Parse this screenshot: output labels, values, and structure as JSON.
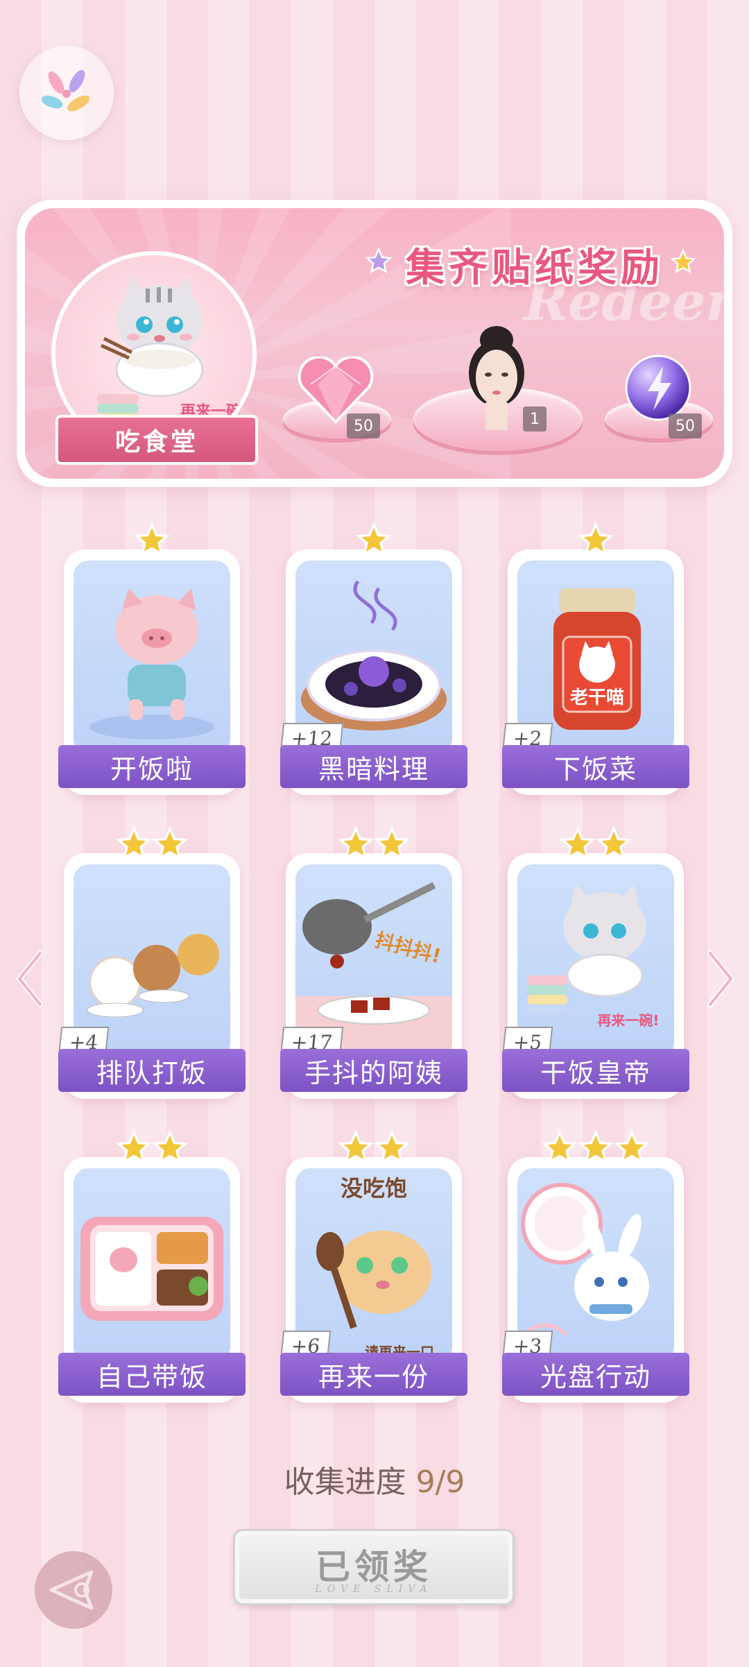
{
  "banner": {
    "title": "集齐贴纸奖励",
    "watermark": "Redeem",
    "badge_label": "吃食堂",
    "badge_caption": "再来一碗!",
    "rewards": [
      {
        "icon": "pink-heart-gem-icon",
        "count": "50"
      },
      {
        "icon": "character-portrait-icon",
        "count": "1"
      },
      {
        "icon": "purple-lightning-orb-icon",
        "count": "50"
      }
    ]
  },
  "cards": [
    {
      "label": "开饭啦",
      "stars": 1,
      "bonus": "",
      "art": "running-pig"
    },
    {
      "label": "黑暗料理",
      "stars": 1,
      "bonus": "+12",
      "art": "dark-dish"
    },
    {
      "label": "下饭菜",
      "stars": 1,
      "bonus": "+2",
      "art": "chili-jar",
      "art_text": "老干喵"
    },
    {
      "label": "排队打饭",
      "stars": 2,
      "bonus": "+4",
      "art": "queue-animals"
    },
    {
      "label": "手抖的阿姨",
      "stars": 2,
      "bonus": "+17",
      "art": "shaky-ladle",
      "art_text": "抖抖抖!"
    },
    {
      "label": "干饭皇帝",
      "stars": 2,
      "bonus": "+5",
      "art": "cat-eating",
      "art_text": "再来一碗!"
    },
    {
      "label": "自己带饭",
      "stars": 2,
      "bonus": "",
      "art": "bento-box"
    },
    {
      "label": "再来一份",
      "stars": 2,
      "bonus": "+6",
      "art": "hamster-spoon",
      "art_text": "没吃饱",
      "art_text2": "请再来一口"
    },
    {
      "label": "光盘行动",
      "stars": 3,
      "bonus": "+3",
      "art": "bunny-plate"
    }
  ],
  "progress": {
    "label": "收集进度",
    "value": "9/9"
  },
  "claim_button": {
    "label": "已领奖",
    "sub": "LOVE SLIVA"
  },
  "colors": {
    "accent_purple": "#8a5fcf",
    "pink": "#e8587f",
    "star": "#f3c63a"
  }
}
